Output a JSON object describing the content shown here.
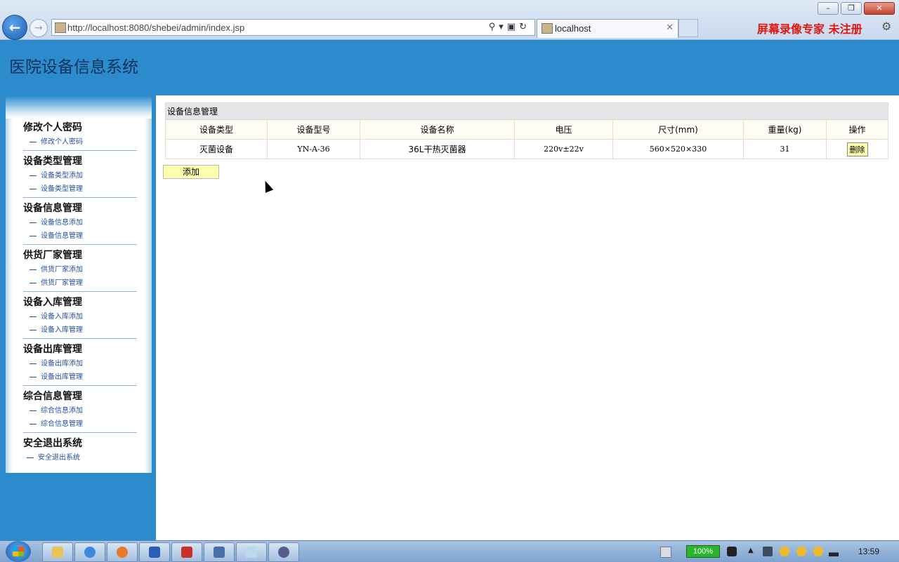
{
  "browser": {
    "url": "http://localhost:8080/shebei/admin/index.jsp",
    "tab_title": "localhost",
    "recorder_watermark": "屏幕录像专家  未注册"
  },
  "page": {
    "system_title": "医院设备信息系统"
  },
  "menu": {
    "groups": [
      {
        "title": "修改个人密码",
        "items": [
          "修改个人密码"
        ]
      },
      {
        "title": "设备类型管理",
        "items": [
          "设备类型添加",
          "设备类型管理"
        ]
      },
      {
        "title": "设备信息管理",
        "items": [
          "设备信息添加",
          "设备信息管理"
        ]
      },
      {
        "title": "供货厂家管理",
        "items": [
          "供货厂家添加",
          "供货厂家管理"
        ]
      },
      {
        "title": "设备入库管理",
        "items": [
          "设备入库添加",
          "设备入库管理"
        ]
      },
      {
        "title": "设备出库管理",
        "items": [
          "设备出库添加",
          "设备出库管理"
        ]
      },
      {
        "title": "综合信息管理",
        "items": [
          "综合信息添加",
          "综合信息管理"
        ]
      },
      {
        "title": "安全退出系统",
        "items": [
          "安全退出系统"
        ]
      }
    ]
  },
  "table": {
    "caption": "设备信息管理",
    "headers": [
      "设备类型",
      "设备型号",
      "设备名称",
      "电压",
      "尺寸(mm)",
      "重量(kg)",
      "操作"
    ],
    "rows": [
      {
        "type": "灭菌设备",
        "model": "YN-A-36",
        "name": "36L干热灭菌器",
        "voltage": "220v±22v",
        "size": "560×520×330",
        "weight": "31",
        "action": "删除"
      }
    ],
    "add_label": "添加"
  },
  "taskbar": {
    "battery": "100%",
    "time": "13:59"
  }
}
